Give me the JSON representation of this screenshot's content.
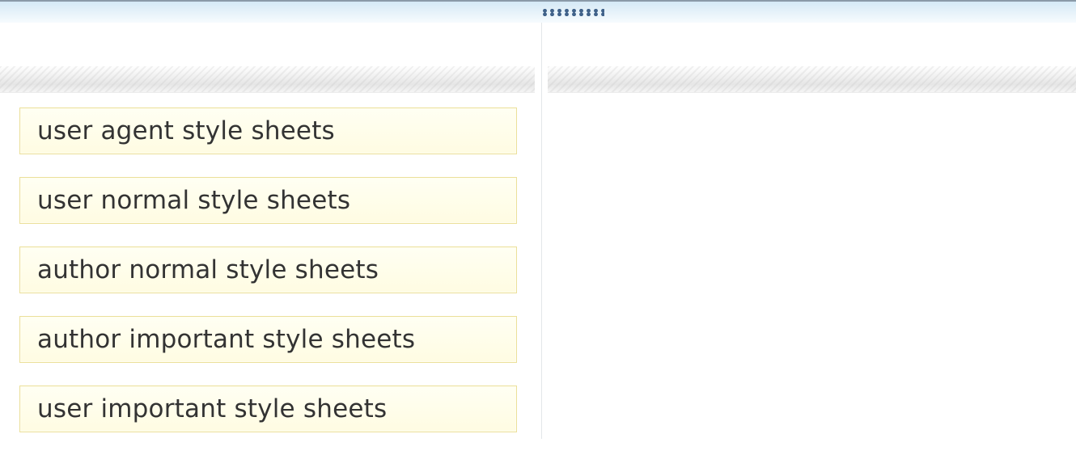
{
  "top_bar": {
    "grip_icon": "drag-grip-dots-icon"
  },
  "source_items": [
    {
      "label": "user agent style sheets"
    },
    {
      "label": "user normal style sheets"
    },
    {
      "label": "author normal style sheets"
    },
    {
      "label": "author important style sheets"
    },
    {
      "label": "user important style sheets"
    }
  ]
}
